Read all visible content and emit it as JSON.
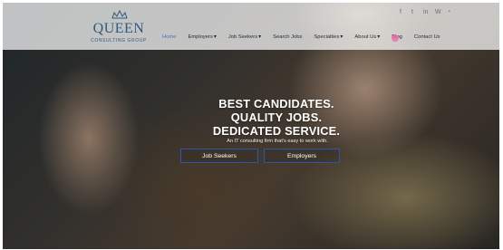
{
  "brand": {
    "name": "QUEEN",
    "subtitle": "CONSULTING GROUP"
  },
  "social_icons": [
    "facebook-icon",
    "twitter-icon",
    "linkedin-icon",
    "wordpress-icon",
    "rss-icon"
  ],
  "nav": {
    "items": [
      {
        "label": "Home",
        "active": true,
        "has_dropdown": false
      },
      {
        "label": "Employers",
        "active": false,
        "has_dropdown": true
      },
      {
        "label": "Job Seekers",
        "active": false,
        "has_dropdown": true
      },
      {
        "label": "Search Jobs",
        "active": false,
        "has_dropdown": false
      },
      {
        "label": "Specialties",
        "active": false,
        "has_dropdown": true
      },
      {
        "label": "About Us",
        "active": false,
        "has_dropdown": true
      },
      {
        "label": "Blog",
        "active": false,
        "has_dropdown": false
      },
      {
        "label": "Contact Us",
        "active": false,
        "has_dropdown": false
      }
    ]
  },
  "hero": {
    "title_line1": "BEST CANDIDATES.",
    "title_line2": "QUALITY JOBS.",
    "title_line3": "DEDICATED SERVICE.",
    "subtitle": "An IT consulting firm that's easy to work with.",
    "buttons": {
      "job_seekers": "Job Seekers",
      "employers": "Employers"
    }
  },
  "colors": {
    "accent": "#3A79C5",
    "brand": "#2E5B7F",
    "button_border": "#2D5AB9",
    "pink_marker": "#F26AA7"
  }
}
